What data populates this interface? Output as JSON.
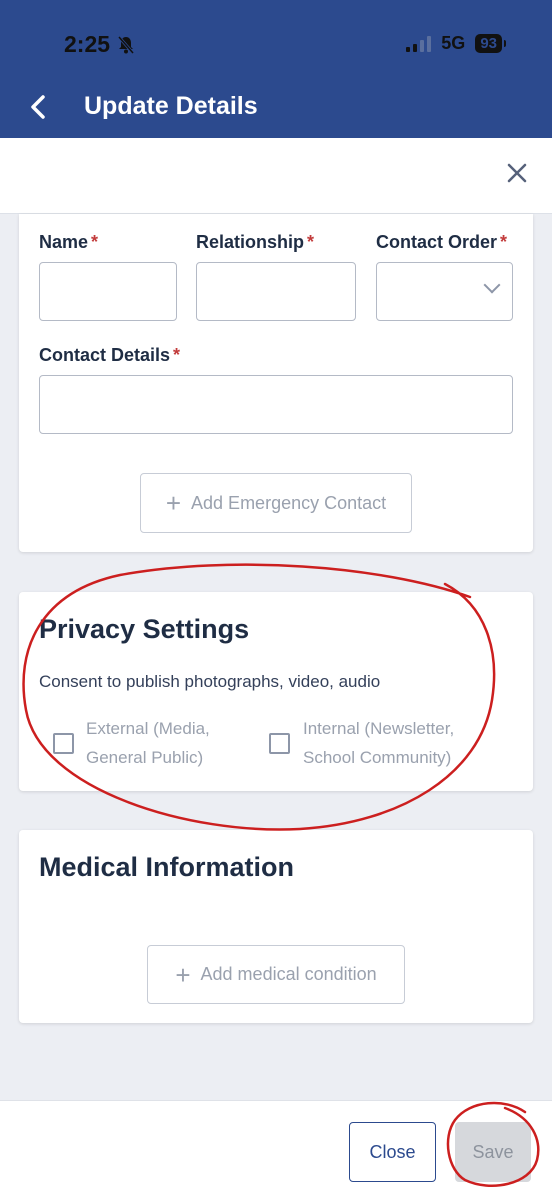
{
  "status_bar": {
    "time": "2:25",
    "network": "5G",
    "battery": "93"
  },
  "nav": {
    "title": "Update Details"
  },
  "emergency_contact": {
    "labels": {
      "name": "Name",
      "relationship": "Relationship",
      "contact_order": "Contact Order",
      "contact_details": "Contact Details"
    },
    "required_mark": "*",
    "add_button": "Add Emergency Contact"
  },
  "privacy": {
    "title": "Privacy Settings",
    "consent_text": "Consent to publish photographs, video, audio",
    "options": [
      {
        "line1": "External (Media,",
        "line2": "General Public)"
      },
      {
        "line1": "Internal (Newsletter,",
        "line2": "School Community)"
      }
    ]
  },
  "medical": {
    "title": "Medical Information",
    "add_button": "Add medical condition"
  },
  "footer": {
    "close_label": "Close",
    "save_label": "Save"
  },
  "icons": {
    "back": "chevron-left-icon",
    "close": "close-icon",
    "dropdown": "chevron-down-icon",
    "add": "plus-icon",
    "silent": "bell-slash-icon",
    "signal": "signal-icon",
    "battery": "battery-icon"
  },
  "colors": {
    "header": "#2c4a8e",
    "required": "#c23b3b",
    "annotation": "#cc1f1f"
  }
}
